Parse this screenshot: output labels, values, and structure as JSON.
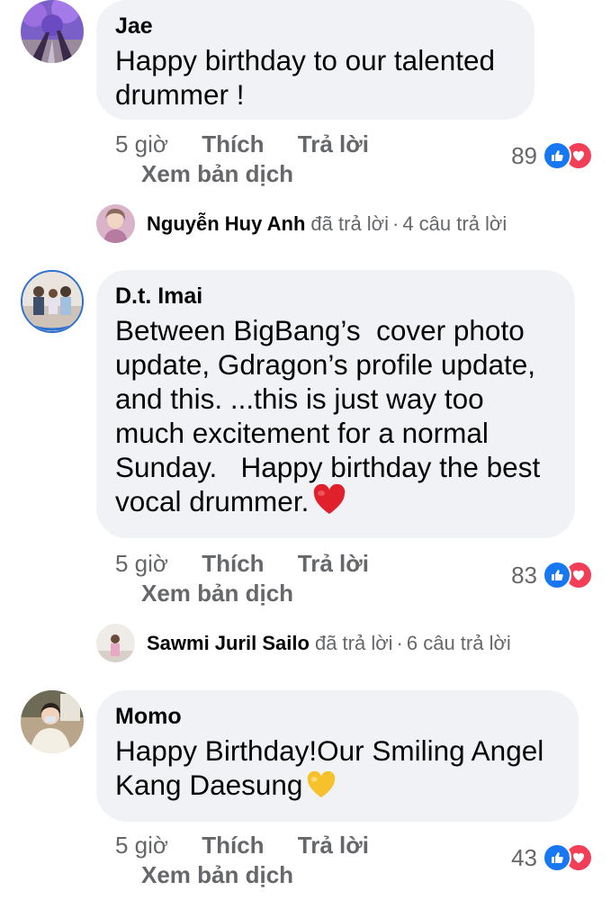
{
  "comments": [
    {
      "author": "Jae",
      "text": "Happy birthday to our talented\ndrummer !",
      "time": "5 giờ",
      "like_label": "Thích",
      "reply_label": "Trả lời",
      "translate_label": "Xem bản dịch",
      "reaction_count": "89",
      "replies": {
        "name": "Nguyễn Huy Anh",
        "action": "đã trả lời",
        "count": "4 câu trả lời"
      }
    },
    {
      "author": "D.t. Imai",
      "text": "Between BigBang’s  cover photo\nupdate, Gdragon’s profile update,\nand this. ...this is just way too\nmuch excitement for a normal\nSunday.   Happy birthday the best\nvocal drummer.",
      "time": "5 giờ",
      "like_label": "Thích",
      "reply_label": "Trả lời",
      "translate_label": "Xem bản dịch",
      "reaction_count": "83",
      "replies": {
        "name": "Sawmi Juril Sailo",
        "action": "đã trả lời",
        "count": "6 câu trả lời"
      }
    },
    {
      "author": "Momo",
      "text": "Happy Birthday!Our Smiling Angel\nKang Daesung",
      "time": "5 giờ",
      "like_label": "Thích",
      "reply_label": "Trả lời",
      "translate_label": "Xem bản dịch",
      "reaction_count": "43"
    }
  ],
  "colors": {
    "bubble": "#f0f2f5",
    "meta_text": "#65676b",
    "like_blue": "#1877f2",
    "love_red": "#f33e58"
  },
  "icons": {
    "like": "thumbs-up-icon",
    "love": "heart-icon",
    "red_heart": "red-heart-emoji",
    "yellow_heart": "yellow-heart-emoji"
  }
}
